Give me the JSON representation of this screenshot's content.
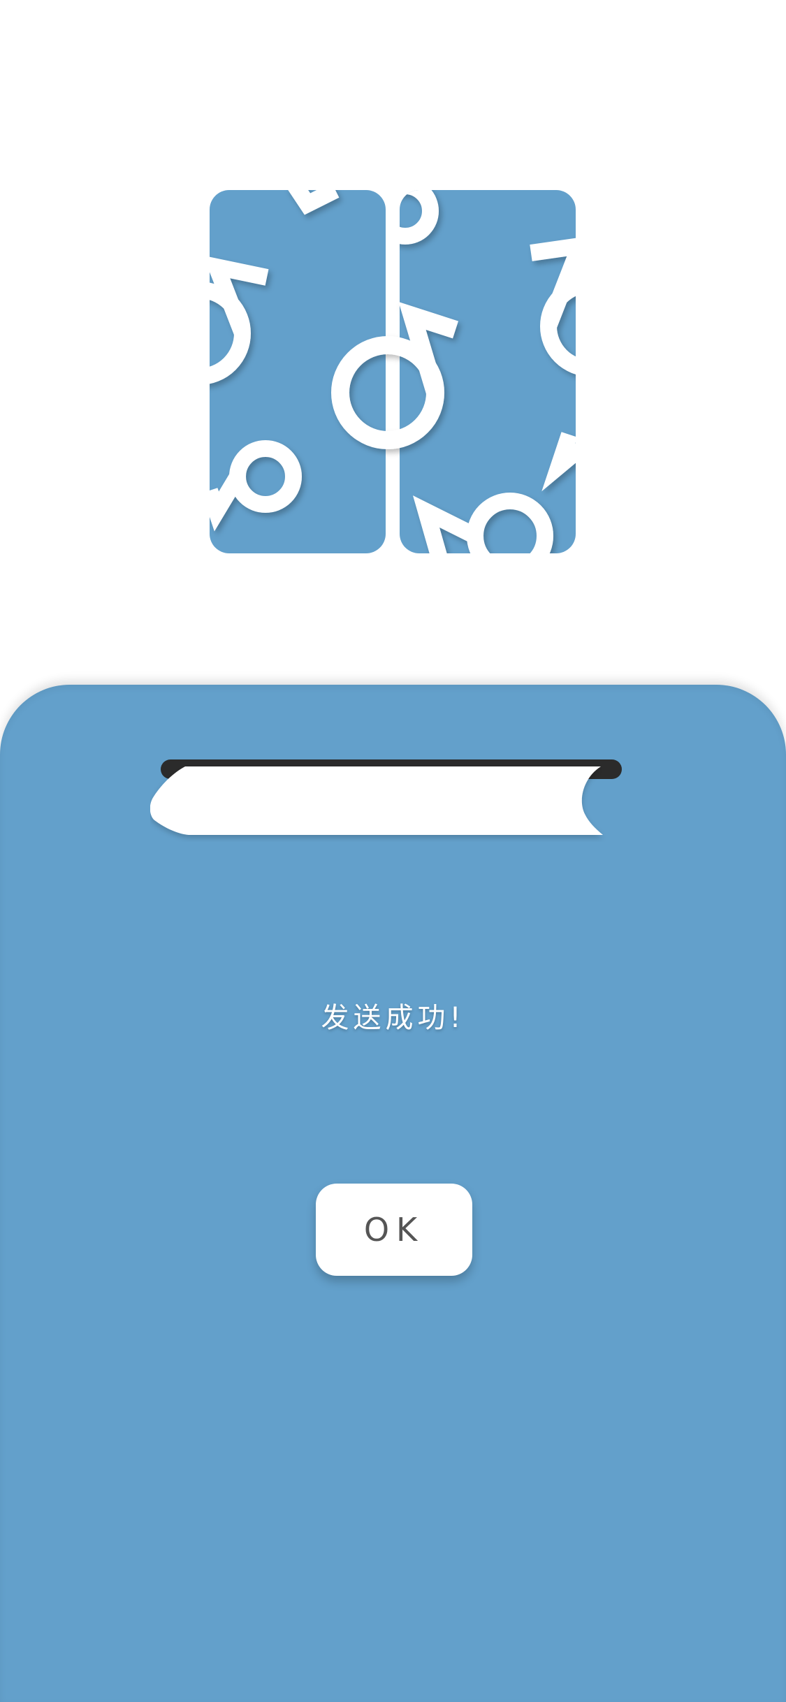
{
  "colors": {
    "panel": "#63a0cb",
    "logo_fill": "#63a0cb",
    "note_color": "#ffffff",
    "slot_dark": "#2b2b2b",
    "button_text": "#555555"
  },
  "logo": {
    "icon": "music-notes-logo-icon"
  },
  "dialog": {
    "message": "发送成功!",
    "ok_label": "OK"
  }
}
